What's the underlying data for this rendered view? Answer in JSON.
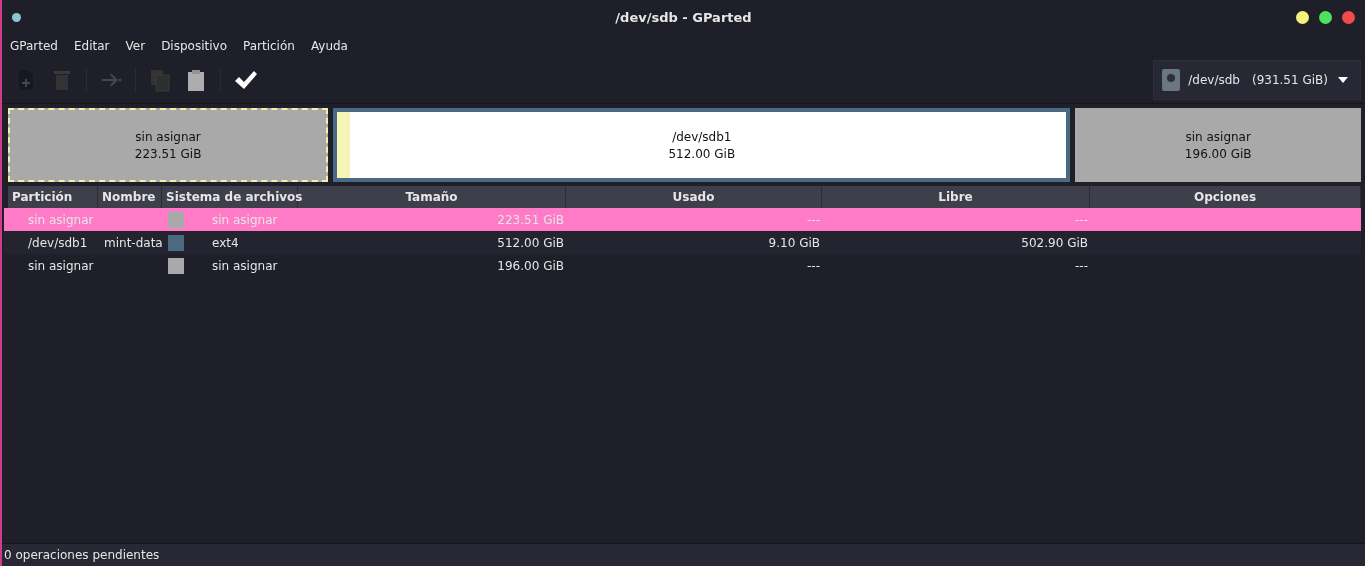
{
  "window": {
    "title": "/dev/sdb - GParted"
  },
  "menu": [
    "GParted",
    "Editar",
    "Ver",
    "Dispositivo",
    "Partición",
    "Ayuda"
  ],
  "toolbar": [
    {
      "kind": "new",
      "disabled": true
    },
    {
      "kind": "delete",
      "disabled": true
    },
    {
      "kind": "resize",
      "disabled": true
    },
    {
      "kind": "copy",
      "disabled": true
    },
    {
      "kind": "paste",
      "disabled": true
    },
    {
      "kind": "apply",
      "disabled": false
    }
  ],
  "device": {
    "name": "/dev/sdb",
    "size": "(931.51 GiB)"
  },
  "partition_map": [
    {
      "kind": "unallocated",
      "label": "sin asignar",
      "size": "223.51 GiB",
      "selected": true
    },
    {
      "kind": "partition",
      "label": "/dev/sdb1",
      "size": "512.00 GiB",
      "level": 0.018,
      "selected": false
    },
    {
      "kind": "unallocated",
      "label": "sin asignar",
      "size": "196.00 GiB",
      "selected": false
    }
  ],
  "table": {
    "columns": [
      "Partición",
      "Nombre",
      "Sistema de archivos",
      "Tamaño",
      "Usado",
      "Libre",
      "Opciones"
    ],
    "rows": [
      {
        "partition": "sin asignar",
        "name": "",
        "filesystem": "sin asignar",
        "color": "#a9a9a9",
        "size": "223.51 GiB",
        "used": "---",
        "free": "---",
        "selected": true
      },
      {
        "partition": "/dev/sdb1",
        "name": "mint-data",
        "filesystem": "ext4",
        "color": "#4b6983",
        "size": "512.00 GiB",
        "used": "9.10 GiB",
        "free": "502.90 GiB",
        "selected": false
      },
      {
        "partition": "sin asignar",
        "name": "",
        "filesystem": "sin asignar",
        "color": "#a9a9a9",
        "size": "196.00 GiB",
        "used": "---",
        "free": "---",
        "selected": false
      }
    ]
  },
  "status_bar": "0 operaciones pendientes"
}
